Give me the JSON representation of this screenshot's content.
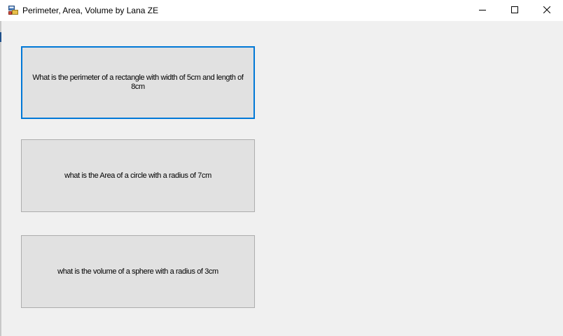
{
  "window": {
    "title": "Perimeter, Area, Volume by Lana ZE",
    "icon": "winforms-app-icon",
    "controls": {
      "minimize": "minimize-icon",
      "maximize": "maximize-icon",
      "close": "close-icon"
    }
  },
  "buttons": [
    {
      "label": "What is the perimeter of a rectangle with width of 5cm and length of 8cm",
      "focused": true
    },
    {
      "label": "what is the Area of a circle with a radius of 7cm",
      "focused": false
    },
    {
      "label": "what is the volume of a sphere with a radius of 3cm",
      "focused": false
    }
  ],
  "colors": {
    "focus_border": "#0078d7",
    "button_face": "#e1e1e1",
    "button_border": "#adadad",
    "window_bg": "#f0f0f0"
  }
}
